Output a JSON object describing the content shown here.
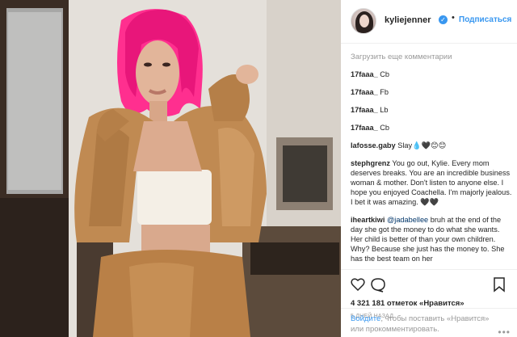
{
  "post": {
    "username": "kyliejenner",
    "follow_label": "Подписаться",
    "separator": "•"
  },
  "comments": {
    "load_more": "Загрузить еще комментарии",
    "items": [
      {
        "user": "17faaa_",
        "text": "Cb"
      },
      {
        "user": "17faaa_",
        "text": "Fb"
      },
      {
        "user": "17faaa_",
        "text": "Lb"
      },
      {
        "user": "17faaa_",
        "text": "Cb"
      },
      {
        "user": "lafosse.gaby",
        "text": "Slay💧🖤😊😊"
      },
      {
        "user": "stephgrenz",
        "text": "You go out, Kylie. Every mom deserves breaks. You are an incredible business woman & mother. Don't listen to anyone else. I hope you enjoyed Coachella. I'm majorly jealous. I bet it was amazing. 🖤🖤"
      },
      {
        "user": "iheartkiwi",
        "mention": "@jadabellee",
        "text": "bruh at the end of the day she got the money to do what she wants. Her child is better of than your own children. Why? Because she just has the money to. She has the best team on her"
      }
    ]
  },
  "footer": {
    "likes": "4 321 181 отметок «Нравится»",
    "time": "5 ДНЕЙ НАЗАД",
    "login_link": "Войдите",
    "login_text": ", чтобы поставить «Нравится» или прокомментировать.",
    "more": "•••"
  },
  "colors": {
    "accent": "#3897f0",
    "hair": "#ff2f8f",
    "jacket": "#c08a52",
    "top": "#f4efe6"
  },
  "icons": [
    "verified-badge-icon",
    "heart-icon",
    "comment-icon",
    "bookmark-icon",
    "more-icon"
  ]
}
